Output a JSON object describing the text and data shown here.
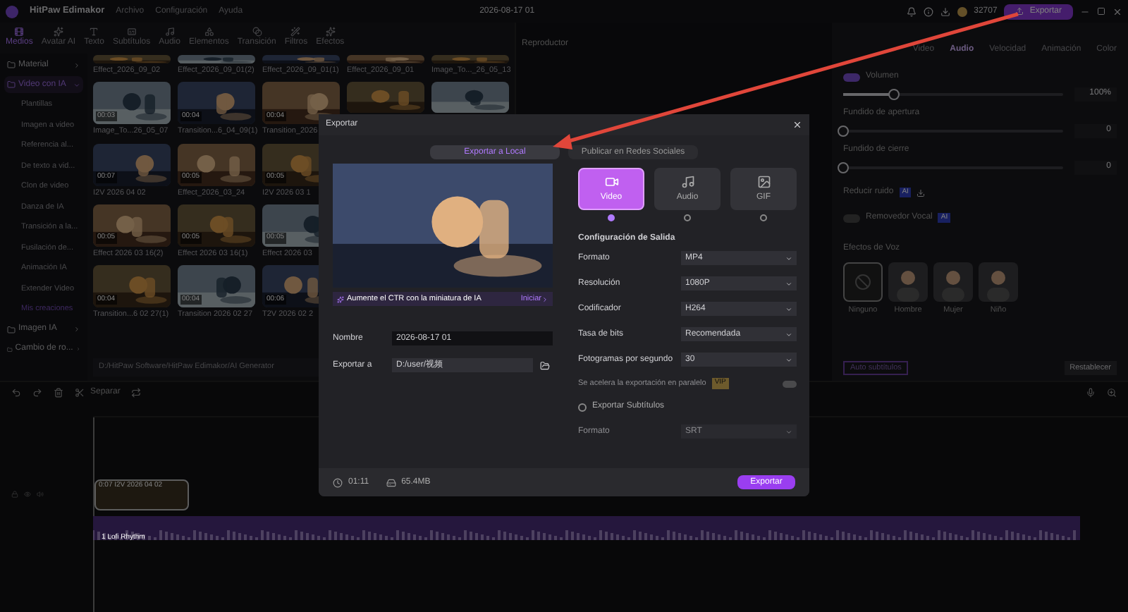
{
  "app": {
    "name": "HitPaw Edimakor",
    "menus": [
      "Archivo",
      "Configuración",
      "Ayuda"
    ],
    "project_title": "2026-08-17 01",
    "coins": "32707",
    "export_button": "Exportar"
  },
  "toolbar_tabs": [
    {
      "label": "Medios",
      "selected": true
    },
    {
      "label": "Avatar AI",
      "selected": false
    },
    {
      "label": "Texto",
      "selected": false
    },
    {
      "label": "Subtítulos",
      "selected": false
    },
    {
      "label": "Audio",
      "selected": false
    },
    {
      "label": "Elementos",
      "selected": false
    },
    {
      "label": "Transición",
      "selected": false
    },
    {
      "label": "Filtros",
      "selected": false
    },
    {
      "label": "Efectos",
      "selected": false
    }
  ],
  "sidebar": {
    "items": [
      {
        "label": "Material",
        "selected": false,
        "expanded": false
      },
      {
        "label": "Video con IA",
        "selected": true,
        "expanded": true,
        "children": [
          {
            "label": "Plantillas"
          },
          {
            "label": "Imagen a video"
          },
          {
            "label": "Referencia al..."
          },
          {
            "label": "De texto a vid..."
          },
          {
            "label": "Clon de video"
          },
          {
            "label": "Danza de IA"
          },
          {
            "label": "Transición a la..."
          },
          {
            "label": "Fusilación de..."
          },
          {
            "label": "Animación IA"
          },
          {
            "label": "Extender Video"
          },
          {
            "label": "Mis creaciones",
            "kind": "link"
          }
        ]
      },
      {
        "label": "Imagen IA",
        "selected": false,
        "expanded": false
      },
      {
        "label": "Cambio de ro...",
        "selected": false,
        "expanded": false
      }
    ]
  },
  "media_rows": [
    [
      {
        "label": "Effect_2026_09_02"
      },
      {
        "label": "Effect_2026_09_01(2)"
      },
      {
        "label": "Effect_2026_09_01(1)"
      },
      {
        "label": "Effect_2026_09_01"
      },
      {
        "label": "Image_To..._26_05_13"
      }
    ],
    [
      {
        "label": "Image_To...26_05_07",
        "duration": "00:03"
      },
      {
        "label": "Transition...6_04_09(1)",
        "duration": "00:04"
      },
      {
        "label": "Transition_2026",
        "duration": "00:04"
      },
      {
        "kind": "picture"
      },
      {
        "kind": "picture"
      }
    ],
    [
      {
        "label": "I2V 2026 04 02",
        "duration": "00:07"
      },
      {
        "label": "Effect_2026_03_24",
        "duration": "00:05"
      },
      {
        "label": "I2V 2026 03 1",
        "duration": "00:05"
      }
    ],
    [
      {
        "label": "Effect 2026 03 16(2)",
        "duration": "00:05"
      },
      {
        "label": "Effect 2026 03 16(1)",
        "duration": "00:05"
      },
      {
        "label": "Effect 2026 03",
        "duration": "00:05"
      }
    ],
    [
      {
        "label": "Transition...6 02 27(1)",
        "duration": "00:04"
      },
      {
        "label": "Transition 2026 02 27",
        "duration": "00:04"
      },
      {
        "label": "T2V 2026 02 2",
        "duration": "00:06"
      }
    ]
  ],
  "media_path": "D:/HitPaw Software/HitPaw Edimakor/AI Generator",
  "player": {
    "title": "Reproductor"
  },
  "properties": {
    "tabs": [
      {
        "label": "Video",
        "selected": false
      },
      {
        "label": "Audio",
        "selected": true
      },
      {
        "label": "Velocidad",
        "selected": false
      },
      {
        "label": "Animación",
        "selected": false
      },
      {
        "label": "Color",
        "selected": false
      }
    ],
    "sliders": [
      {
        "label": "Volumen",
        "toggle": true,
        "on": true,
        "level": 0.23,
        "value": "100%"
      },
      {
        "label": "Fundido de apertura",
        "level": 0,
        "value": "0"
      },
      {
        "label": "Fundido de cierre",
        "level": 0,
        "value": "0"
      }
    ],
    "noise_reduction": {
      "label": "Reducir ruido",
      "badge": "AI"
    },
    "vocal_remover": {
      "label": "Removedor Vocal",
      "badge": "AI",
      "on": false
    },
    "voice_effects": {
      "title": "Efectos de Voz",
      "options": [
        {
          "label": "Ninguno",
          "kind": "none",
          "selected": true
        },
        {
          "label": "Hombre",
          "kind": "figure",
          "selected": false
        },
        {
          "label": "Mujer",
          "kind": "figure",
          "selected": false
        },
        {
          "label": "Niño",
          "kind": "figure",
          "selected": false
        }
      ]
    },
    "auto_subtitles": "Auto subtítulos",
    "reset": "Restablecer"
  },
  "timeline": {
    "split_label": "Separar",
    "video_clip": {
      "duration": "0:07",
      "label": "I2V 2026 04 02"
    },
    "audio_clip": {
      "label": "1 Lofi Rhythm"
    }
  },
  "export_dialog": {
    "title": "Exportar",
    "tabs": [
      {
        "label": "Exportar a Local",
        "selected": true
      },
      {
        "label": "Publicar en Redes Sociales",
        "selected": false
      }
    ],
    "banner": {
      "text": "Aumente el CTR con la miniatura de IA",
      "action": "Iniciar"
    },
    "fields": [
      {
        "label": "Nombre",
        "value": "2026-08-17 01",
        "kind": "text"
      },
      {
        "label": "Exportar a",
        "value": "D:/user/视频",
        "kind": "folder"
      }
    ],
    "types": [
      {
        "label": "Video",
        "kind": "video",
        "selected": true
      },
      {
        "label": "Audio",
        "kind": "audio",
        "selected": false
      },
      {
        "label": "GIF",
        "kind": "gif",
        "selected": false
      }
    ],
    "settings_title": "Configuración de Salida",
    "settings": [
      {
        "label": "Formato",
        "value": "MP4"
      },
      {
        "label": "Resolución",
        "value": "1080P"
      },
      {
        "label": "Codificador",
        "value": "H264"
      },
      {
        "label": "Tasa de bits",
        "value": "Recomendada"
      },
      {
        "label": "Fotogramas por segundo",
        "value": "30"
      }
    ],
    "parallel": {
      "label": "Se acelera la exportación en paralelo",
      "badge": "VIP",
      "disabled": true,
      "on": false
    },
    "subtitles": {
      "label": "Exportar Subtítulos",
      "checked": false
    },
    "subtitle_format": {
      "label": "Formato",
      "value": "SRT",
      "disabled": true
    },
    "duration": "01:11",
    "size": "65.4MB",
    "export_button": "Exportar"
  }
}
